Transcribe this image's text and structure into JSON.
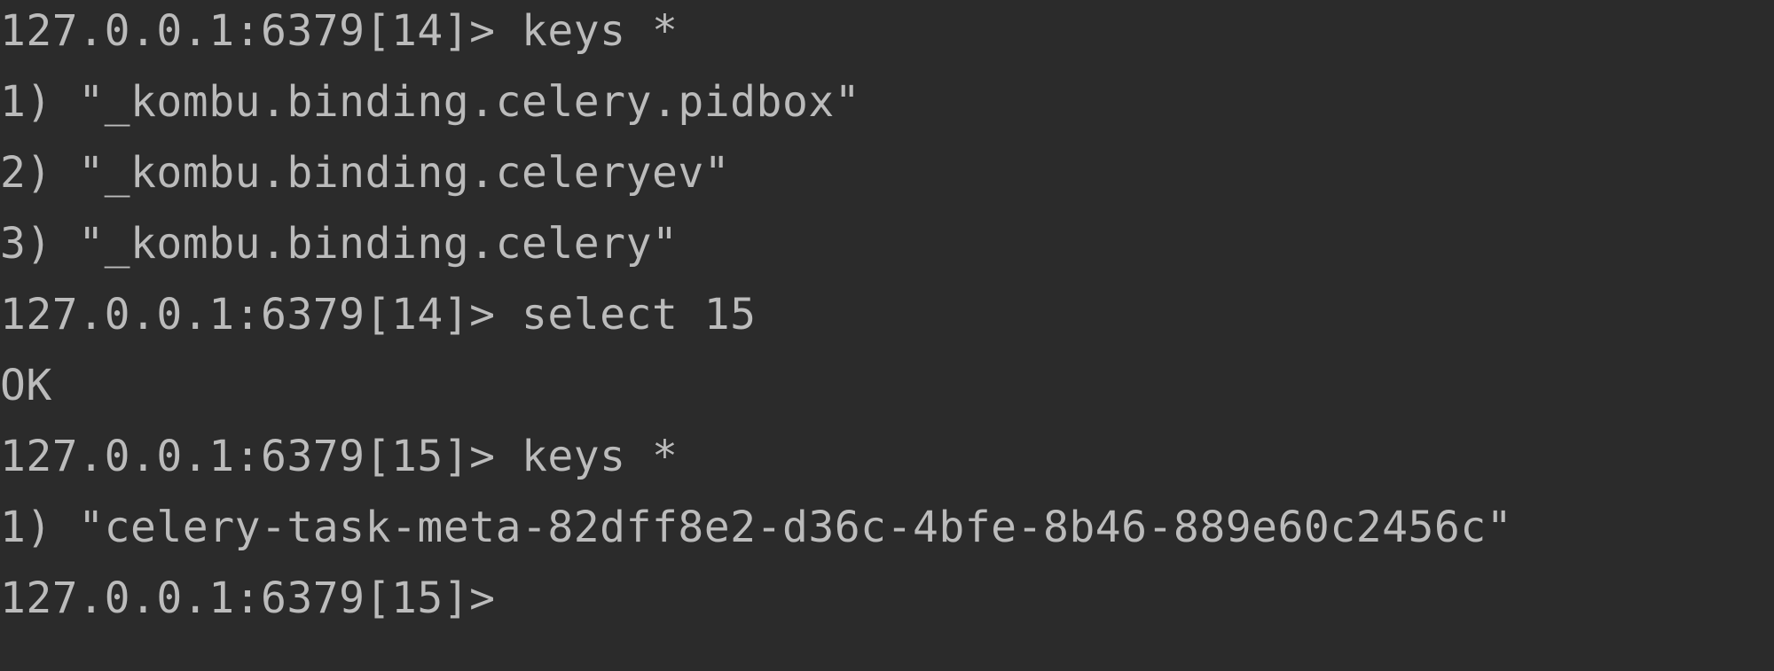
{
  "terminal": {
    "background": "#2b2b2b",
    "foreground": "#bbbbbb",
    "lines": [
      {
        "type": "command",
        "prompt": "127.0.0.1:6379[14]> ",
        "command": "keys *"
      },
      {
        "type": "output",
        "text": "1) \"_kombu.binding.celery.pidbox\""
      },
      {
        "type": "output",
        "text": "2) \"_kombu.binding.celeryev\""
      },
      {
        "type": "output",
        "text": "3) \"_kombu.binding.celery\""
      },
      {
        "type": "command",
        "prompt": "127.0.0.1:6379[14]> ",
        "command": "select 15"
      },
      {
        "type": "output",
        "text": "OK"
      },
      {
        "type": "command",
        "prompt": "127.0.0.1:6379[15]> ",
        "command": "keys *"
      },
      {
        "type": "output",
        "text": "1) \"celery-task-meta-82dff8e2-d36c-4bfe-8b46-889e60c2456c\""
      },
      {
        "type": "command",
        "prompt": "127.0.0.1:6379[15]> ",
        "command": ""
      }
    ]
  }
}
